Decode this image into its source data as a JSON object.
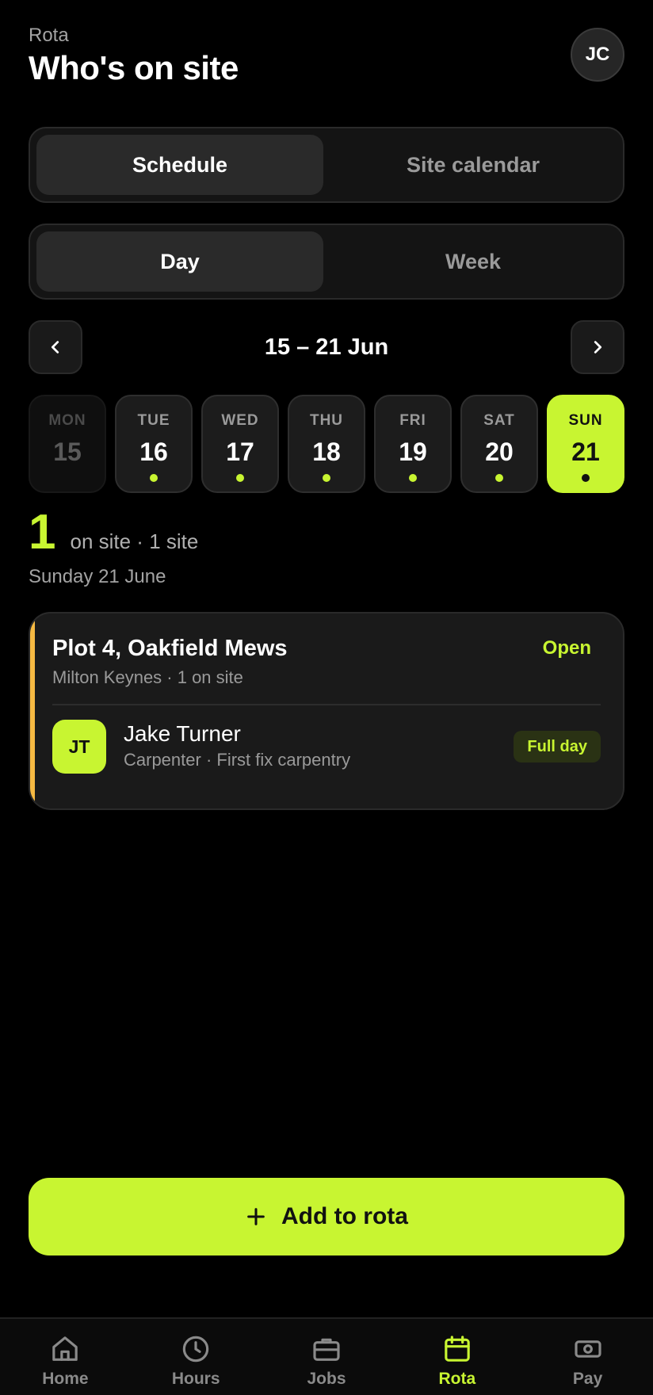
{
  "header": {
    "eyebrow": "Rota",
    "title": "Who's on site",
    "avatar_initials": "JC"
  },
  "view_toggle": {
    "options": [
      "Schedule",
      "Site calendar"
    ],
    "selected": "Schedule"
  },
  "range_toggle": {
    "options": [
      "Day",
      "Week"
    ],
    "selected": "Day"
  },
  "week_nav": {
    "range_label": "15 – 21 Jun",
    "prev_icon": "chevron-left-icon",
    "next_icon": "chevron-right-icon"
  },
  "days": [
    {
      "dow": "MON",
      "num": "15",
      "state": "past",
      "has_dot": false
    },
    {
      "dow": "TUE",
      "num": "16",
      "state": "normal",
      "has_dot": true
    },
    {
      "dow": "WED",
      "num": "17",
      "state": "normal",
      "has_dot": true
    },
    {
      "dow": "THU",
      "num": "18",
      "state": "normal",
      "has_dot": true
    },
    {
      "dow": "FRI",
      "num": "19",
      "state": "normal",
      "has_dot": true
    },
    {
      "dow": "SAT",
      "num": "20",
      "state": "normal",
      "has_dot": true
    },
    {
      "dow": "SUN",
      "num": "21",
      "state": "selected",
      "has_dot": true
    }
  ],
  "summary": {
    "count": "1",
    "text": "on site · 1 site",
    "date": "Sunday 21 June"
  },
  "site": {
    "name": "Plot 4, Oakfield Mews",
    "status": "Open",
    "meta": "Milton Keynes · 1 on site",
    "accent_color": "#f5b942",
    "worker": {
      "initials": "JT",
      "name": "Jake Turner",
      "role": "Carpenter · First fix carpentry",
      "shift": "Full day"
    }
  },
  "actions": {
    "add_label": "Add to rota",
    "add_icon": "plus-icon"
  },
  "bottom_nav": {
    "items": [
      {
        "label": "Home",
        "icon": "home-icon",
        "active": false
      },
      {
        "label": "Hours",
        "icon": "clock-icon",
        "active": false
      },
      {
        "label": "Jobs",
        "icon": "briefcase-icon",
        "active": false
      },
      {
        "label": "Rota",
        "icon": "calendar-icon",
        "active": true
      },
      {
        "label": "Pay",
        "icon": "cash-icon",
        "active": false
      }
    ]
  },
  "colors": {
    "accent": "#c8f531",
    "background": "#000000",
    "site_accent": "#f5b942"
  }
}
